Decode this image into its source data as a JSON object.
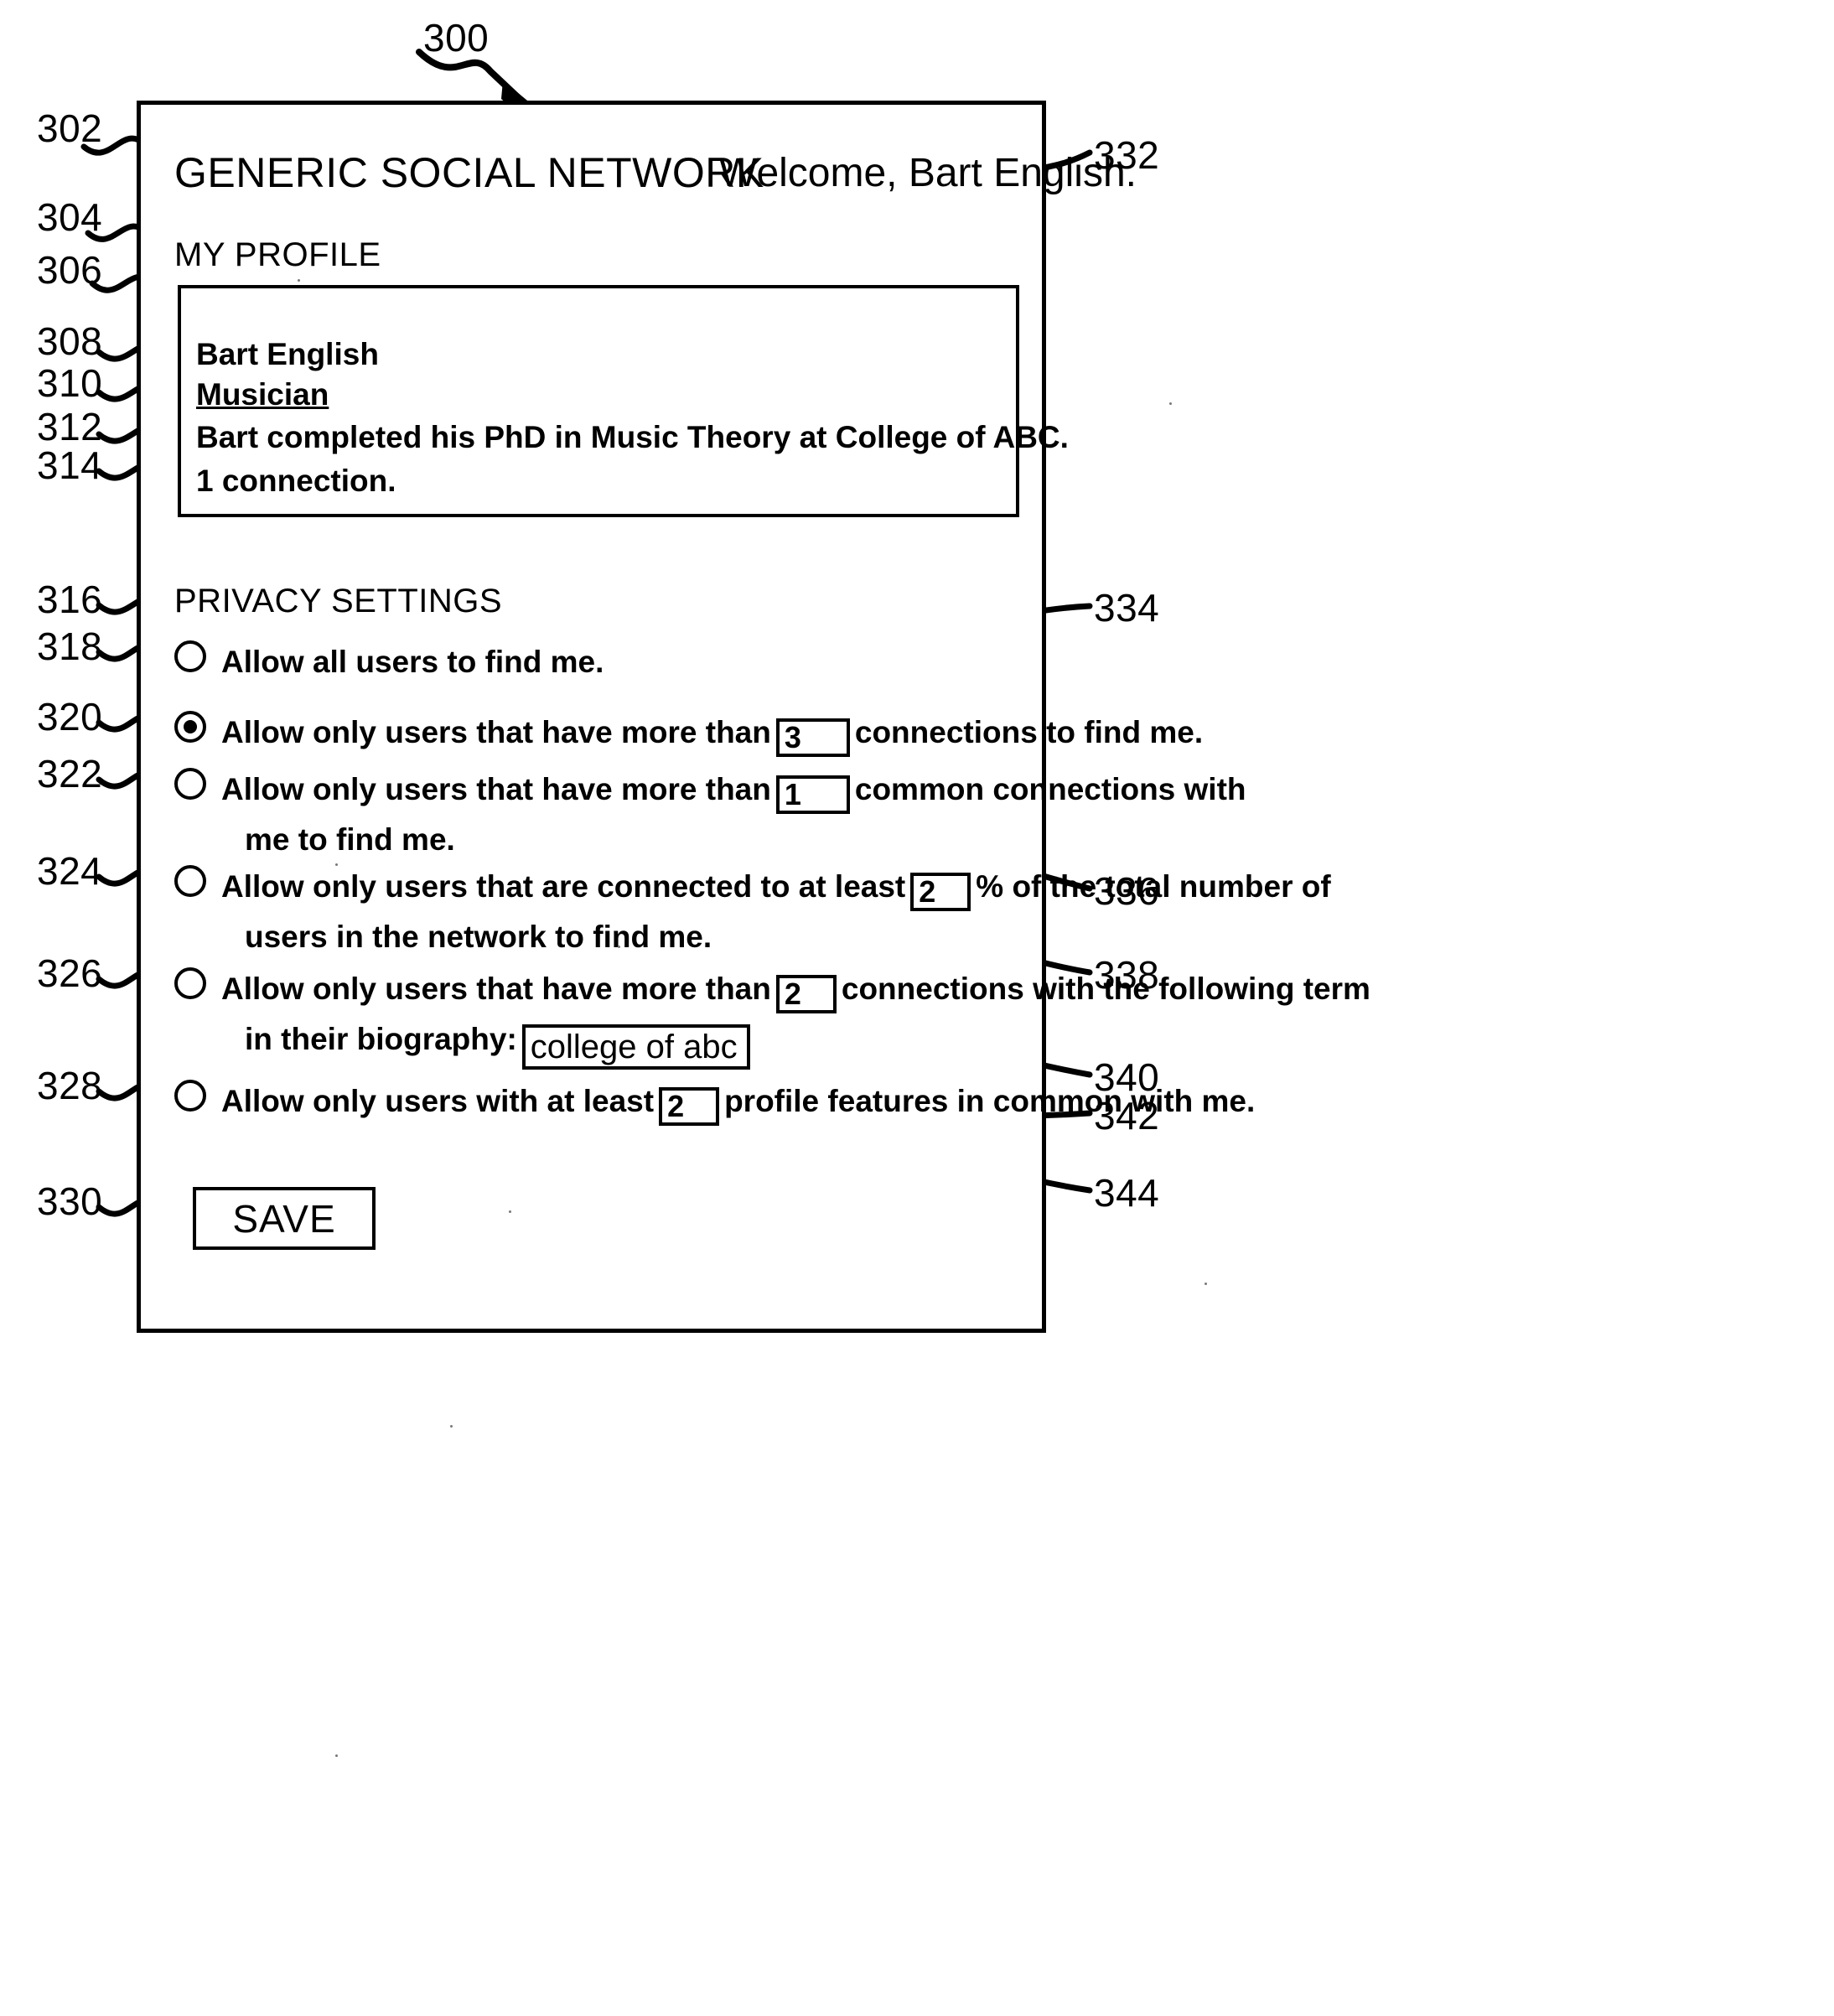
{
  "figure": {
    "number": "300",
    "refs": {
      "fig": "300",
      "screen": "302",
      "my_profile": "304",
      "profile_card": "306",
      "name": "308",
      "occupation": "310",
      "biography": "312",
      "connections": "314",
      "privacy_heading": "316",
      "option_1": "318",
      "option_2": "320",
      "option_3": "322",
      "option_4": "324",
      "option_5": "326",
      "option_6": "328",
      "save": "330",
      "welcome": "332",
      "field_connections": "334",
      "field_common_connections": "336",
      "field_percent": "338",
      "field_term_count": "340",
      "field_features": "342",
      "field_term_text": "344"
    }
  },
  "app": {
    "title": "GENERIC SOCIAL NETWORK",
    "welcome": "Welcome, Bart English."
  },
  "profile": {
    "section_label": "MY PROFILE",
    "name": "Bart English",
    "occupation": "Musician",
    "biography": "Bart completed his PhD in Music Theory at College of ABC.",
    "connections": "1 connection."
  },
  "privacy": {
    "section_label": "PRIVACY SETTINGS",
    "options": [
      {
        "id": "318",
        "selected": false,
        "segments": [
          {
            "type": "text",
            "value": "Allow all users to find me."
          }
        ]
      },
      {
        "id": "320",
        "selected": true,
        "segments": [
          {
            "type": "text",
            "value": "Allow only users that have more than"
          },
          {
            "type": "input",
            "value": "3",
            "ref": "334"
          },
          {
            "type": "text",
            "value": "connections to find me."
          }
        ]
      },
      {
        "id": "322",
        "selected": false,
        "segments": [
          {
            "type": "text",
            "value": "Allow only users that have more than"
          },
          {
            "type": "input",
            "value": "1",
            "ref": "336"
          },
          {
            "type": "text",
            "value": "common connections with"
          },
          {
            "type": "break",
            "value": "me to find me."
          }
        ]
      },
      {
        "id": "324",
        "selected": false,
        "segments": [
          {
            "type": "text",
            "value": "Allow only users that are connected to at least"
          },
          {
            "type": "input",
            "value": "2",
            "ref": "338"
          },
          {
            "type": "text",
            "value": "% of the total number of"
          },
          {
            "type": "break",
            "value": "users in the network to find me."
          }
        ]
      },
      {
        "id": "326",
        "selected": false,
        "segments": [
          {
            "type": "text",
            "value": "Allow only users that have more than"
          },
          {
            "type": "input",
            "value": "2",
            "ref": "340"
          },
          {
            "type": "text",
            "value": "connections with the following term"
          },
          {
            "type": "break",
            "value": "in their biography:"
          },
          {
            "type": "input_term",
            "value": "college of abc",
            "ref": "344"
          }
        ]
      },
      {
        "id": "328",
        "selected": false,
        "segments": [
          {
            "type": "text",
            "value": "Allow only users with at least"
          },
          {
            "type": "input",
            "value": "2",
            "ref": "342"
          },
          {
            "type": "text",
            "value": "profile features in common with me."
          }
        ]
      }
    ]
  },
  "actions": {
    "save_label": "SAVE"
  }
}
